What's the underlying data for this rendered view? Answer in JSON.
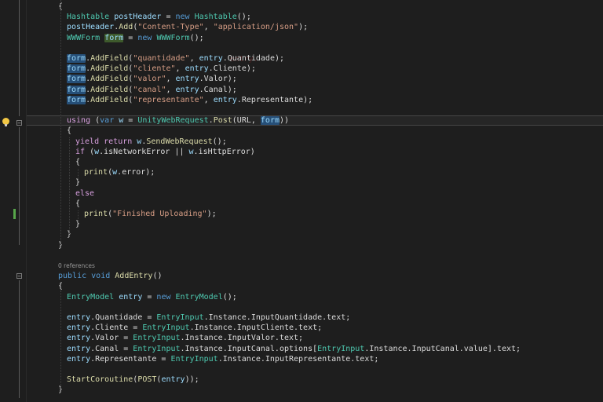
{
  "editor": {
    "theme": {
      "background": "#1e1e1e",
      "keyword": "#569cd6",
      "type": "#4ec9b0",
      "string": "#d69d85",
      "method": "#dcdcaa",
      "highlight": "#264f78"
    },
    "lines": [
      {
        "indent": 4,
        "text": "{"
      },
      {
        "indent": 6,
        "text": "Hashtable postHeader = new Hashtable();"
      },
      {
        "indent": 6,
        "text": "postHeader.Add(\"Content-Type\", \"application/json\");"
      },
      {
        "indent": 6,
        "text": "WWWForm form = new WWWForm();"
      },
      {
        "indent": 0,
        "text": ""
      },
      {
        "indent": 6,
        "text": "form.AddField(\"quantidade\", entry.Quantidade);"
      },
      {
        "indent": 6,
        "text": "form.AddField(\"cliente\", entry.Cliente);"
      },
      {
        "indent": 6,
        "text": "form.AddField(\"valor\", entry.Valor);"
      },
      {
        "indent": 6,
        "text": "form.AddField(\"canal\", entry.Canal);"
      },
      {
        "indent": 6,
        "text": "form.AddField(\"representante\", entry.Representante);"
      },
      {
        "indent": 0,
        "text": ""
      },
      {
        "indent": 6,
        "text": "using (var w = UnityWebRequest.Post(URL, form))"
      },
      {
        "indent": 6,
        "text": "{"
      },
      {
        "indent": 8,
        "text": "yield return w.SendWebRequest();"
      },
      {
        "indent": 8,
        "text": "if (w.isNetworkError || w.isHttpError)"
      },
      {
        "indent": 8,
        "text": "{"
      },
      {
        "indent": 10,
        "text": "print(w.error);"
      },
      {
        "indent": 8,
        "text": "}"
      },
      {
        "indent": 8,
        "text": "else"
      },
      {
        "indent": 8,
        "text": "{"
      },
      {
        "indent": 10,
        "text": "print(\"Finished Uploading\");"
      },
      {
        "indent": 8,
        "text": "}"
      },
      {
        "indent": 6,
        "text": "}"
      },
      {
        "indent": 4,
        "text": "}"
      },
      {
        "indent": 0,
        "text": ""
      },
      {
        "indent": 4,
        "text": "0 references"
      },
      {
        "indent": 4,
        "text": "public void AddEntry()"
      },
      {
        "indent": 4,
        "text": "{"
      },
      {
        "indent": 6,
        "text": "EntryModel entry = new EntryModel();"
      },
      {
        "indent": 0,
        "text": ""
      },
      {
        "indent": 6,
        "text": "entry.Quantidade = EntryInput.Instance.InputQuantidade.text;"
      },
      {
        "indent": 6,
        "text": "entry.Cliente = EntryInput.Instance.InputCliente.text;"
      },
      {
        "indent": 6,
        "text": "entry.Valor = EntryInput.Instance.InputValor.text;"
      },
      {
        "indent": 6,
        "text": "entry.Canal = EntryInput.Instance.InputCanal.options[EntryInput.Instance.InputCanal.value].text;"
      },
      {
        "indent": 6,
        "text": "entry.Representante = EntryInput.Instance.InputRepresentante.text;"
      },
      {
        "indent": 0,
        "text": ""
      },
      {
        "indent": 6,
        "text": "StartCoroutine(POST(entry));"
      },
      {
        "indent": 4,
        "text": "}"
      }
    ]
  }
}
